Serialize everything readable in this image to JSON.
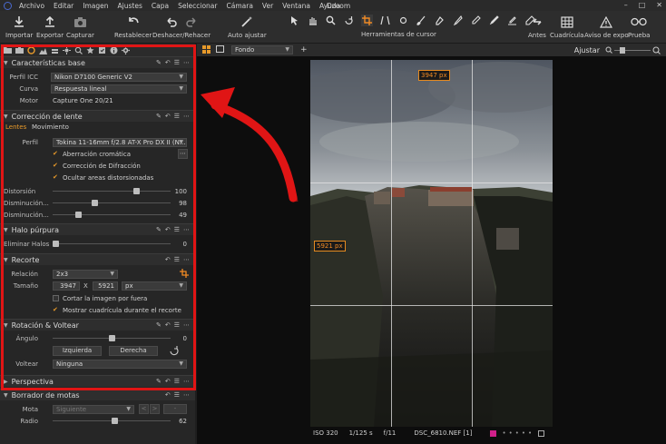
{
  "menubar": {
    "items": [
      "Archivo",
      "Editar",
      "Imagen",
      "Ajustes",
      "Capa",
      "Seleccionar",
      "Cámara",
      "Ver",
      "Ventana",
      "Ayuda"
    ],
    "title": "Dzoom"
  },
  "toolbar": {
    "importar": "Importar",
    "exportar": "Exportar",
    "capturar": "Capturar",
    "restablecer": "Restablecer",
    "deshacer": "Deshacer/Rehacer",
    "auto": "Auto ajustar",
    "cursor_tools": "Herramientas de cursor",
    "antes": "Antes",
    "cuadricula": "Cuadrícula",
    "aviso": "Aviso de expo",
    "prueba": "Prueba"
  },
  "viewer": {
    "fondo": "Fondo",
    "ajustar": "Ajustar",
    "width_label": "3947 px",
    "height_label": "5921 px"
  },
  "status": {
    "iso": "ISO 320",
    "shutter": "1/125 s",
    "aperture": "f/11",
    "filename": "DSC_6810.NEF [1]"
  },
  "caracteristicas": {
    "title": "Características base",
    "perfil_label": "Perfil ICC",
    "perfil_value": "Nikon D7100 Generic V2",
    "curva_label": "Curva",
    "curva_value": "Respuesta lineal",
    "motor_label": "Motor",
    "motor_value": "Capture One 20/21"
  },
  "lente": {
    "title": "Corrección de lente",
    "tab_lentes": "Lentes",
    "tab_movimiento": "Movimiento",
    "perfil_label": "Perfil",
    "perfil_value": "Tokina 11-16mm f/2.8 AT-X Pro DX II (N...",
    "aberracion": "Aberración cromática",
    "difraccion": "Corrección de Difracción",
    "ocultar": "Ocultar areas distorsionadas",
    "distorsion_label": "Distorsión",
    "distorsion_value": "100",
    "dism1_label": "Disminución...",
    "dism1_value": "98",
    "dism2_label": "Disminución...",
    "dism2_value": "49",
    "sliders": {
      "distorsion": 0.72,
      "dism1": 0.35,
      "dism2": 0.2
    }
  },
  "halo": {
    "title": "Halo púrpura",
    "eliminar_label": "Eliminar Halos",
    "eliminar_value": "0"
  },
  "recorte": {
    "title": "Recorte",
    "relacion_label": "Relación",
    "relacion_value": "2x3",
    "tamano_label": "Tamaño",
    "width": "3947",
    "x": "X",
    "height": "5921",
    "unit": "px",
    "cortar": "Cortar la imagen por fuera",
    "mostrar": "Mostrar cuadrícula durante el recorte"
  },
  "rotacion": {
    "title": "Rotación & Voltear",
    "angulo_label": "Ángulo",
    "angulo_value": "0",
    "izquierda": "Izquierda",
    "derecha": "Derecha",
    "voltear_label": "Voltear",
    "voltear_value": "Ninguna",
    "angulo_slider": 0.5
  },
  "perspectiva": {
    "title": "Perspectiva"
  },
  "motas": {
    "title": "Borrador de motas",
    "mota_label": "Mota",
    "mota_value": "Siguiente",
    "radio_label": "Radio",
    "radio_value": "62"
  }
}
